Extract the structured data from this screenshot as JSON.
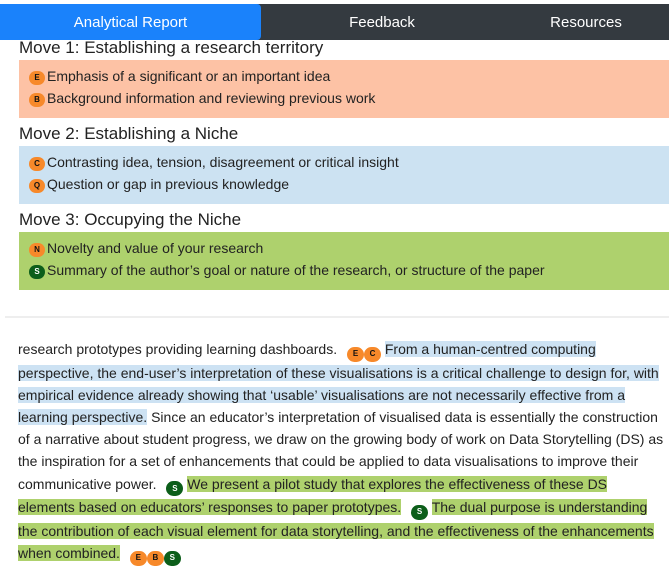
{
  "tabs": [
    {
      "label": "Analytical Report",
      "active": true
    },
    {
      "label": "Feedback",
      "active": false
    },
    {
      "label": "Resources",
      "active": false
    }
  ],
  "colors": {
    "tab_active": "#1a82fb",
    "tab_bar": "#343a40",
    "move1_bg": "#fdc2a5",
    "move2_bg": "#cce2f2",
    "move3_bg": "#aed16d",
    "badge_orange": "#f7892a",
    "badge_green": "#0c5e1a"
  },
  "moves": [
    {
      "title": "Move 1: Establishing a research territory",
      "items": [
        {
          "code": "E",
          "label": "Emphasis of a significant or an important idea",
          "color": "orange"
        },
        {
          "code": "B",
          "label": "Background information and reviewing previous work",
          "color": "orange"
        }
      ]
    },
    {
      "title": "Move 2: Establishing a Niche",
      "items": [
        {
          "code": "C",
          "label": "Contrasting idea, tension, disagreement or critical insight",
          "color": "orange"
        },
        {
          "code": "Q",
          "label": "Question or gap in previous knowledge",
          "color": "orange"
        }
      ]
    },
    {
      "title": "Move 3: Occupying the Niche",
      "items": [
        {
          "code": "N",
          "label": "Novelty and value of your research",
          "color": "orange"
        },
        {
          "code": "S",
          "label": "Summary of the author’s goal or nature of the research, or structure of the paper",
          "color": "green"
        }
      ]
    }
  ],
  "document": {
    "seg1": "research prototypes providing learning dashboards.",
    "badges1": [
      "E",
      "C"
    ],
    "seg2_highlight_blue": "From a human-centred computing perspective, the end-user’s interpretation of these visualisations is a critical challenge to design for, with empirical evidence already showing that ‘usable’ visualisations are not necessarily effective from a learning perspective.",
    "seg3": "Since an educator’s interpretation of visualised data is essentially the construction of a narrative about student progress, we draw on the growing body of work on Data Storytelling (DS) as the inspiration for a set of enhancements that could be applied to data visualisations to improve their communicative power.",
    "badges3": [
      "S"
    ],
    "seg4_highlight_green": "We present a pilot study that explores the effectiveness of these DS elements based on educators’ responses to paper prototypes.",
    "badges4": [
      "S"
    ],
    "seg5_highlight_green": "The dual purpose is understanding the contribution of each visual element for data storytelling, and the effectiveness of the enhancements when combined.",
    "badges5": [
      "E",
      "B",
      "S"
    ]
  }
}
